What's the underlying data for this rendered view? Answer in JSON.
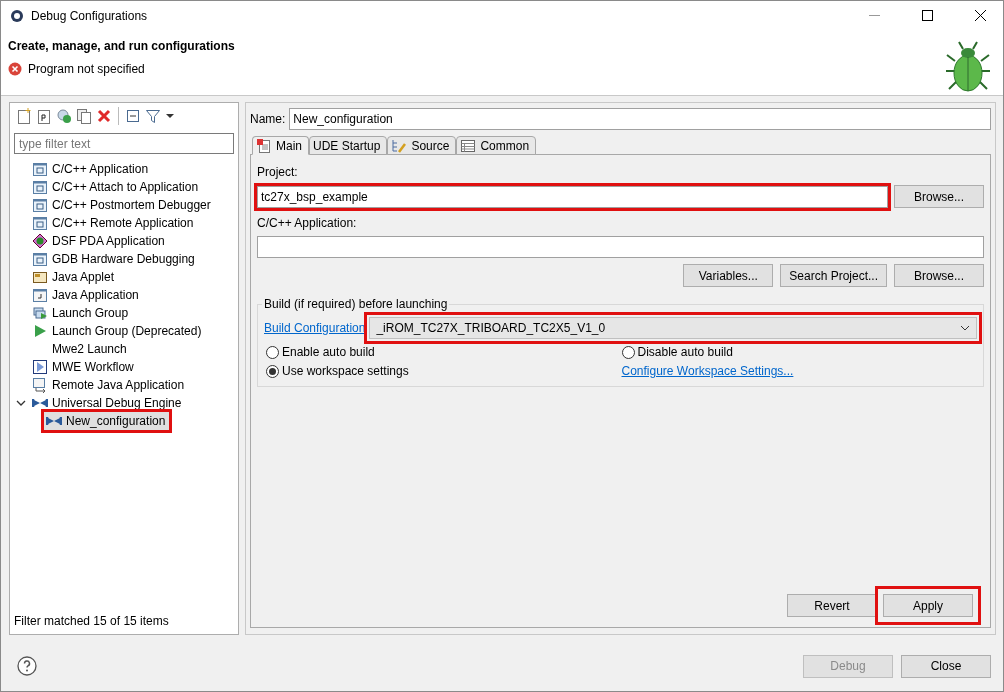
{
  "window": {
    "title": "Debug Configurations"
  },
  "header": {
    "title": "Create, manage, and run configurations",
    "message": "Program not specified"
  },
  "filter": {
    "placeholder": "type filter text"
  },
  "tree": [
    {
      "label": "C/C++ Application",
      "kind": "c",
      "selected": false
    },
    {
      "label": "C/C++ Attach to Application",
      "kind": "c",
      "selected": false
    },
    {
      "label": "C/C++ Postmortem Debugger",
      "kind": "c",
      "selected": false
    },
    {
      "label": "C/C++ Remote Application",
      "kind": "c",
      "selected": false
    },
    {
      "label": "DSF PDA Application",
      "kind": "dsf",
      "selected": false
    },
    {
      "label": "GDB Hardware Debugging",
      "kind": "c",
      "selected": false
    },
    {
      "label": "Java Applet",
      "kind": "applet",
      "selected": false
    },
    {
      "label": "Java Application",
      "kind": "java",
      "selected": false
    },
    {
      "label": "Launch Group",
      "kind": "group",
      "selected": false
    },
    {
      "label": "Launch Group (Deprecated)",
      "kind": "play",
      "selected": false
    },
    {
      "label": "Mwe2 Launch",
      "kind": "none",
      "selected": false
    },
    {
      "label": "MWE Workflow",
      "kind": "mwe",
      "selected": false
    },
    {
      "label": "Remote Java Application",
      "kind": "remote",
      "selected": false
    },
    {
      "label": "Universal Debug Engine",
      "kind": "ude",
      "selected": false,
      "expanded": true,
      "children": [
        {
          "label": "New_configuration",
          "kind": "ude",
          "selected": true,
          "highlighted": true
        }
      ]
    }
  ],
  "filter_status": "Filter matched 15 of 15 items",
  "name": {
    "label": "Name:",
    "value": "New_configuration"
  },
  "tabs": [
    {
      "label": "Main",
      "kind": "main",
      "selected": true
    },
    {
      "label": "UDE Startup",
      "kind": "none",
      "selected": false
    },
    {
      "label": "Source",
      "kind": "source",
      "selected": false
    },
    {
      "label": "Common",
      "kind": "common",
      "selected": false
    }
  ],
  "project": {
    "label": "Project:",
    "value": "tc27x_bsp_example",
    "highlighted": true,
    "button": "Browse..."
  },
  "application": {
    "label": "C/C++ Application:",
    "buttons": [
      "Variables...",
      "Search Project...",
      "Browse..."
    ]
  },
  "build": {
    "legend": "Build (if required) before launching",
    "link": "Build Configuration",
    "combo": "_iROM_TC27X_TRIBOARD_TC2X5_V1_0",
    "highlighted": true,
    "options": [
      {
        "label": "Enable auto build",
        "selected": false
      },
      {
        "label": "Disable auto build",
        "selected": false
      },
      {
        "label": "Use workspace settings",
        "selected": true
      }
    ],
    "settings_link": "Configure Workspace Settings..."
  },
  "actions": [
    {
      "label": "Revert",
      "highlighted": false
    },
    {
      "label": "Apply",
      "highlighted": true
    }
  ],
  "footer": [
    {
      "label": "Debug",
      "disabled": true
    },
    {
      "label": "Close",
      "disabled": false
    }
  ]
}
